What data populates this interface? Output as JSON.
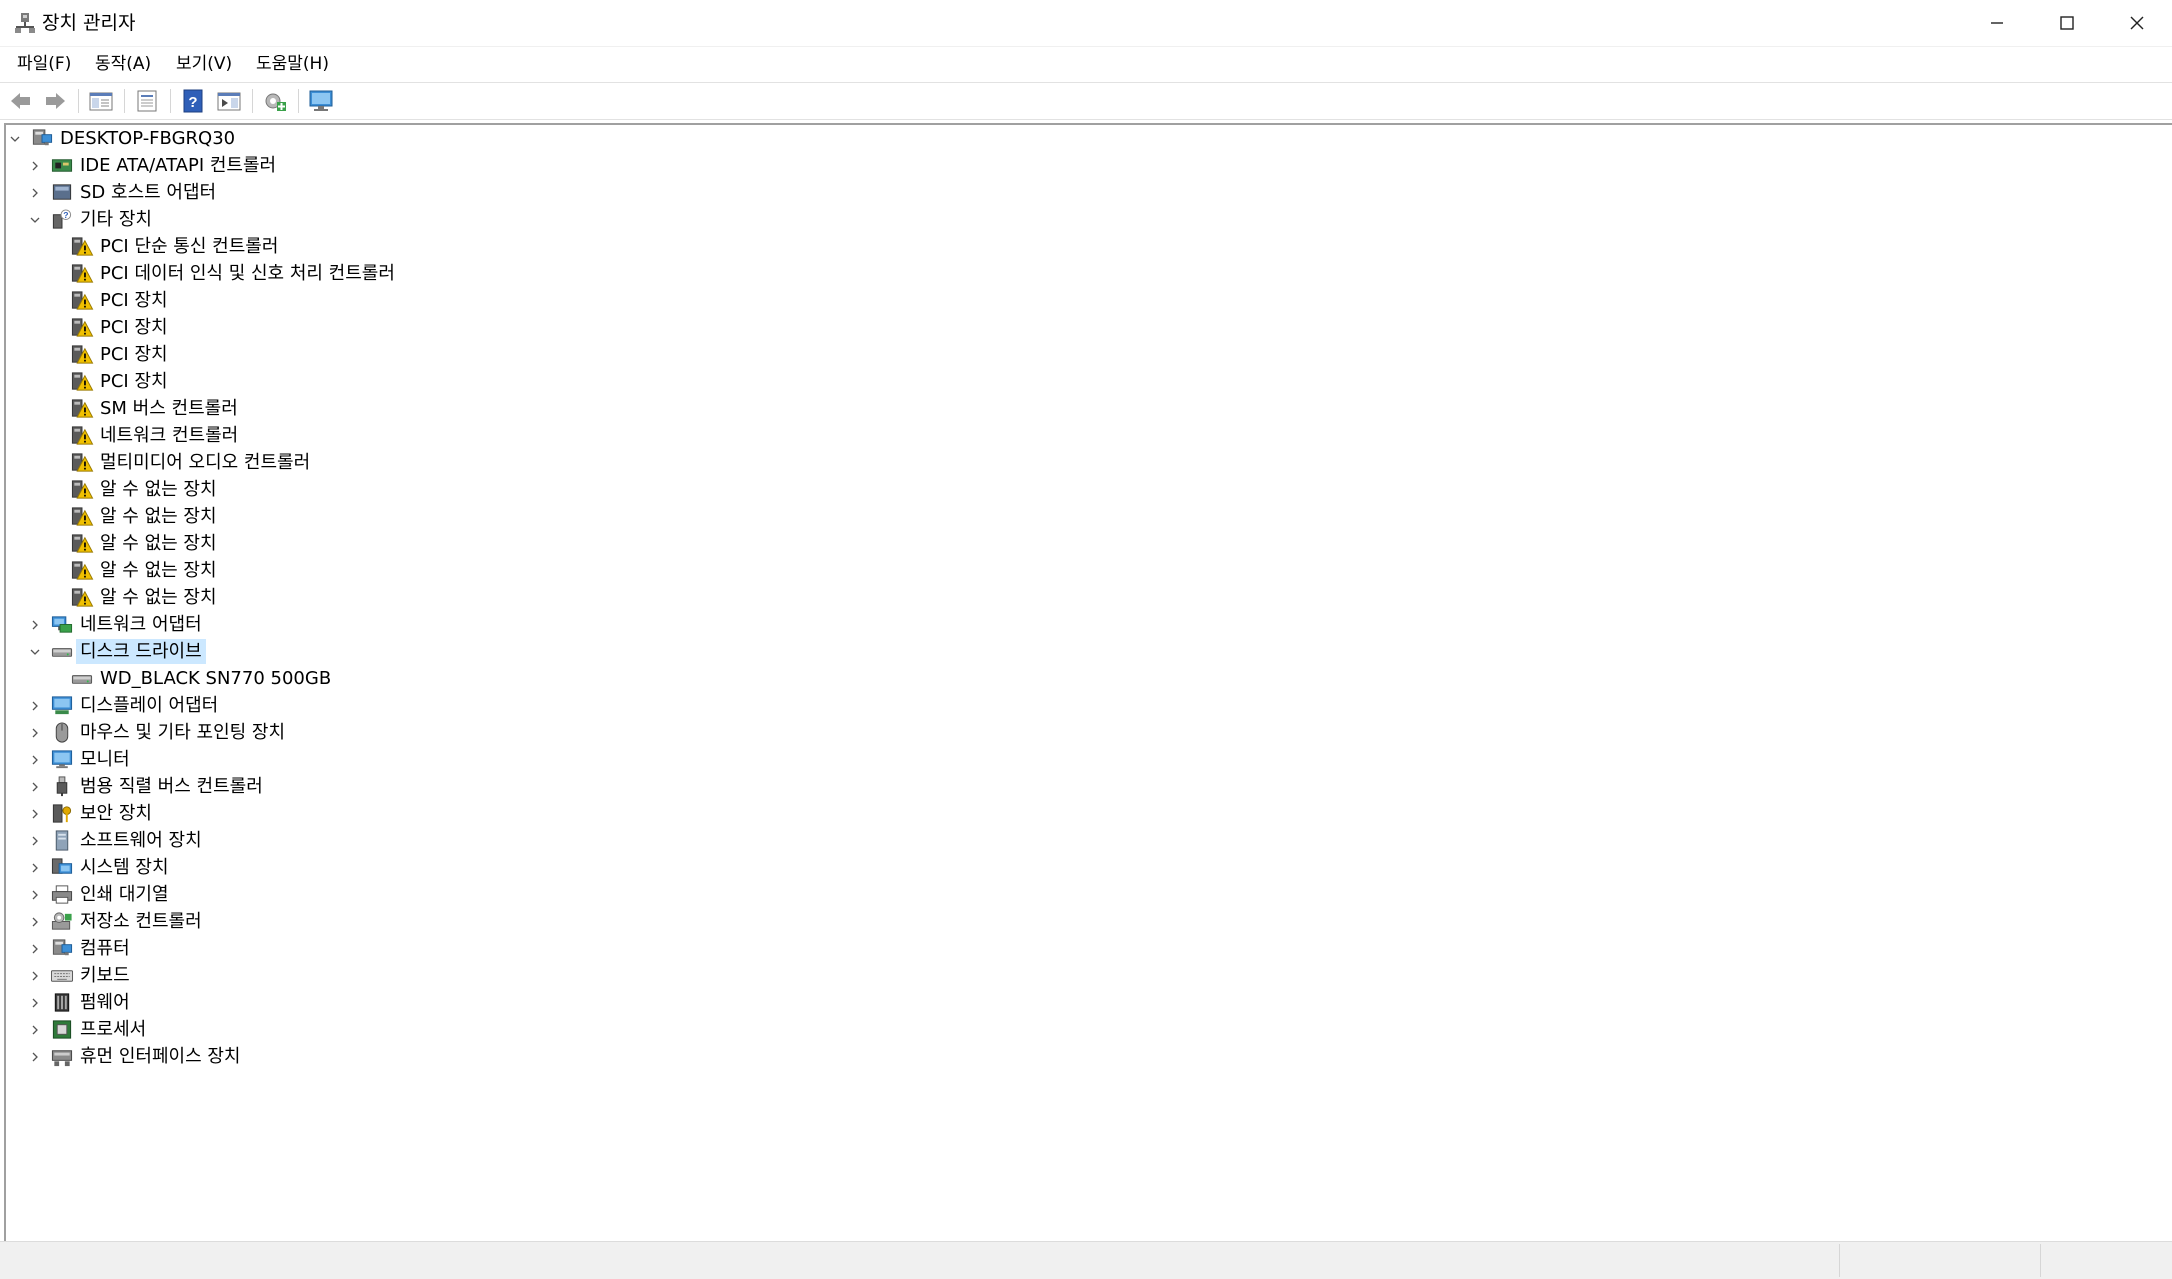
{
  "window": {
    "title": "장치 관리자"
  },
  "menu": [
    "파일(F)",
    "동작(A)",
    "보기(V)",
    "도움말(H)"
  ],
  "toolbar": {
    "buttons": [
      {
        "icon": "back-arrow-icon"
      },
      {
        "icon": "forward-arrow-icon"
      },
      {
        "icon": "show-hide-tree-icon"
      },
      {
        "icon": "properties-icon"
      },
      {
        "icon": "help-icon"
      },
      {
        "icon": "action-pane-icon"
      },
      {
        "icon": "scan-hardware-changes-icon"
      },
      {
        "icon": "monitor-icon"
      }
    ]
  },
  "tree": [
    {
      "level": 0,
      "expander": "expanded",
      "icon": "computer-icon",
      "label": "DESKTOP-FBGRQ30"
    },
    {
      "level": 1,
      "expander": "collapsed",
      "icon": "ide-controller-icon",
      "label": "IDE ATA/ATAPI 컨트롤러"
    },
    {
      "level": 1,
      "expander": "collapsed",
      "icon": "sd-host-icon",
      "label": "SD 호스트 어댑터"
    },
    {
      "level": 1,
      "expander": "expanded",
      "icon": "unknown-device-icon",
      "label": "기타 장치"
    },
    {
      "level": 2,
      "expander": "none",
      "icon": "warning-device-icon",
      "label": "PCI 단순 통신 컨트롤러"
    },
    {
      "level": 2,
      "expander": "none",
      "icon": "warning-device-icon",
      "label": "PCI 데이터 인식 및 신호 처리 컨트롤러"
    },
    {
      "level": 2,
      "expander": "none",
      "icon": "warning-device-icon",
      "label": "PCI 장치"
    },
    {
      "level": 2,
      "expander": "none",
      "icon": "warning-device-icon",
      "label": "PCI 장치"
    },
    {
      "level": 2,
      "expander": "none",
      "icon": "warning-device-icon",
      "label": "PCI 장치"
    },
    {
      "level": 2,
      "expander": "none",
      "icon": "warning-device-icon",
      "label": "PCI 장치"
    },
    {
      "level": 2,
      "expander": "none",
      "icon": "warning-device-icon",
      "label": "SM 버스 컨트롤러"
    },
    {
      "level": 2,
      "expander": "none",
      "icon": "warning-device-icon",
      "label": "네트워크 컨트롤러"
    },
    {
      "level": 2,
      "expander": "none",
      "icon": "warning-device-icon",
      "label": "멀티미디어 오디오 컨트롤러"
    },
    {
      "level": 2,
      "expander": "none",
      "icon": "warning-device-icon",
      "label": "알 수 없는 장치"
    },
    {
      "level": 2,
      "expander": "none",
      "icon": "warning-device-icon",
      "label": "알 수 없는 장치"
    },
    {
      "level": 2,
      "expander": "none",
      "icon": "warning-device-icon",
      "label": "알 수 없는 장치"
    },
    {
      "level": 2,
      "expander": "none",
      "icon": "warning-device-icon",
      "label": "알 수 없는 장치"
    },
    {
      "level": 2,
      "expander": "none",
      "icon": "warning-device-icon",
      "label": "알 수 없는 장치"
    },
    {
      "level": 1,
      "expander": "collapsed",
      "icon": "network-adapter-icon",
      "label": "네트워크 어댑터"
    },
    {
      "level": 1,
      "expander": "expanded",
      "icon": "disk-drive-icon",
      "label": "디스크 드라이브",
      "selected": true
    },
    {
      "level": 2,
      "expander": "none",
      "icon": "disk-drive-icon",
      "label": "WD_BLACK SN770 500GB"
    },
    {
      "level": 1,
      "expander": "collapsed",
      "icon": "display-adapter-icon",
      "label": "디스플레이 어댑터"
    },
    {
      "level": 1,
      "expander": "collapsed",
      "icon": "mouse-icon",
      "label": "마우스 및 기타 포인팅 장치"
    },
    {
      "level": 1,
      "expander": "collapsed",
      "icon": "monitor-icon",
      "label": "모니터"
    },
    {
      "level": 1,
      "expander": "collapsed",
      "icon": "usb-icon",
      "label": "범용 직렬 버스 컨트롤러"
    },
    {
      "level": 1,
      "expander": "collapsed",
      "icon": "security-device-icon",
      "label": "보안 장치"
    },
    {
      "level": 1,
      "expander": "collapsed",
      "icon": "software-device-icon",
      "label": "소프트웨어 장치"
    },
    {
      "level": 1,
      "expander": "collapsed",
      "icon": "system-device-icon",
      "label": "시스템 장치"
    },
    {
      "level": 1,
      "expander": "collapsed",
      "icon": "printer-icon",
      "label": "인쇄 대기열"
    },
    {
      "level": 1,
      "expander": "collapsed",
      "icon": "storage-controller-icon",
      "label": "저장소 컨트롤러"
    },
    {
      "level": 1,
      "expander": "collapsed",
      "icon": "computer-icon",
      "label": "컴퓨터"
    },
    {
      "level": 1,
      "expander": "collapsed",
      "icon": "keyboard-icon",
      "label": "키보드"
    },
    {
      "level": 1,
      "expander": "collapsed",
      "icon": "firmware-icon",
      "label": "펌웨어"
    },
    {
      "level": 1,
      "expander": "collapsed",
      "icon": "processor-icon",
      "label": "프로세서"
    },
    {
      "level": 1,
      "expander": "collapsed",
      "icon": "hid-icon",
      "label": "휴먼 인터페이스 장치"
    }
  ],
  "colors": {
    "selection": "#cce8ff",
    "warning": "#f0c000",
    "monitor_blue": "#2f8fd8"
  }
}
